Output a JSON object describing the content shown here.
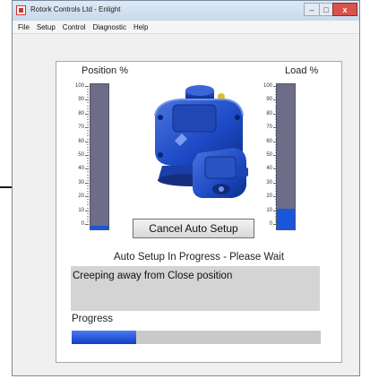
{
  "window": {
    "title": "Rotork Controls Ltd - Enlight",
    "close_glyph": "x"
  },
  "menu": {
    "items": [
      "File",
      "Setup",
      "Control",
      "Diagnostic",
      "Help"
    ]
  },
  "gauges": {
    "position": {
      "label": "Position %",
      "value": 2,
      "max": 100
    },
    "load": {
      "label": "Load %",
      "value": 14,
      "max": 100
    },
    "ticks": [
      100,
      90,
      80,
      70,
      60,
      50,
      40,
      30,
      20,
      10,
      0
    ]
  },
  "image": {
    "icon": "actuator-image"
  },
  "cancel_button": {
    "label": "Cancel Auto Setup"
  },
  "status": {
    "text": "Auto Setup In Progress - Please Wait",
    "message": "Creeping away from Close position"
  },
  "progress": {
    "label": "Progress",
    "value": 0.26
  },
  "colors": {
    "bar_track": "#6e6d87",
    "bar_fill": "#1a56d9",
    "progress_fill": "#0c3fc7"
  }
}
